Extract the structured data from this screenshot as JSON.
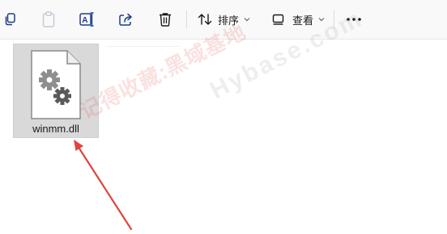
{
  "toolbar": {
    "sort_label": "排序",
    "view_label": "查看",
    "more_label": "···",
    "icons": [
      "copy-icon",
      "paste-icon",
      "rename-icon",
      "share-icon",
      "delete-icon",
      "sort-icon",
      "view-icon",
      "chevron-down-icon",
      "more-icon"
    ]
  },
  "content": {
    "file": {
      "name": "winmm.dll",
      "icon": "dll-file-gear-icon",
      "selected": true
    }
  },
  "watermarks": {
    "text_cn": "记得收藏:黑域基地",
    "text_en": "Hybase.com"
  },
  "colors": {
    "accent_arrow": "#e0443c",
    "tile_selected": "#d9d9d9",
    "toolbar_bg": "#f9f9f9"
  }
}
